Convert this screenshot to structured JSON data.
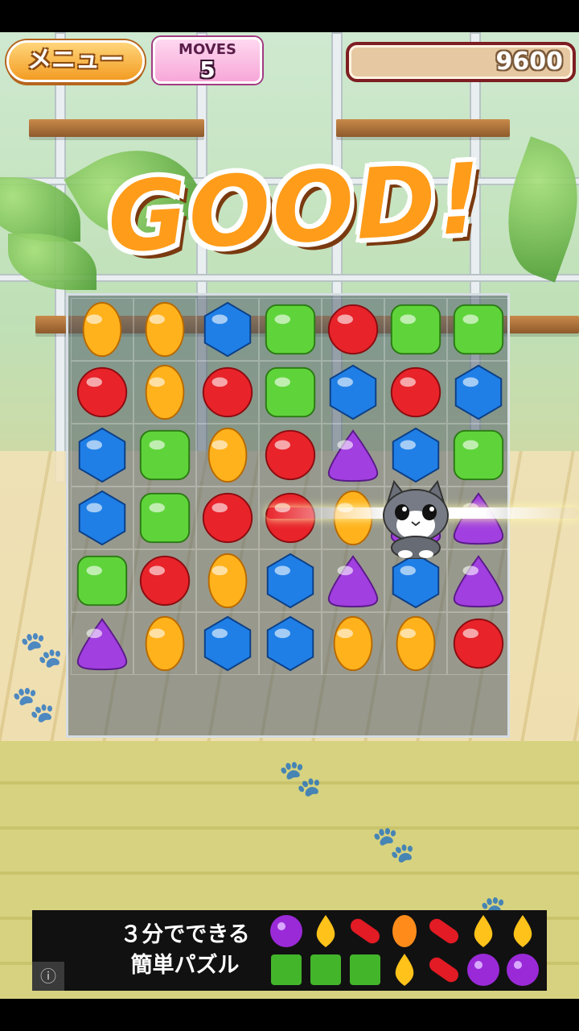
{
  "hud": {
    "menu_label": "メニュー",
    "moves_label": "MOVES",
    "moves_value": "5",
    "score_value": "9600"
  },
  "popup": {
    "text": "GOOD!"
  },
  "board": {
    "rows": [
      [
        "orange",
        "orange",
        "blue",
        "green",
        "red",
        "green",
        "green"
      ],
      [
        "red",
        "orange",
        "red",
        "green",
        "blue",
        "red",
        "blue"
      ],
      [
        "blue",
        "green",
        "orange",
        "red",
        "purple",
        "blue",
        "green"
      ],
      [
        "blue",
        "green",
        "red",
        "red",
        "orange",
        "purple",
        "purple"
      ],
      [
        "green",
        "red",
        "orange",
        "blue",
        "purple",
        "blue",
        "purple"
      ],
      [
        "purple",
        "orange",
        "blue",
        "blue",
        "orange",
        "orange",
        "red"
      ]
    ]
  },
  "colors": {
    "red": "#e8232a",
    "orange": "#ffb21c",
    "blue": "#1f7fe6",
    "green": "#5fd43a",
    "purple": "#a23fe0"
  },
  "ad": {
    "line1": "３分でできる",
    "line2": "簡単パズル",
    "info_icon": "info-icon",
    "candies": [
      "purple-flower",
      "yellow-drop",
      "red-bean",
      "orange-oval",
      "red-bean",
      "yellow-drop",
      "yellow-drop",
      "green-square",
      "green-square",
      "green-square",
      "yellow-drop",
      "red-bean",
      "purple-flower",
      "purple-flower"
    ]
  }
}
